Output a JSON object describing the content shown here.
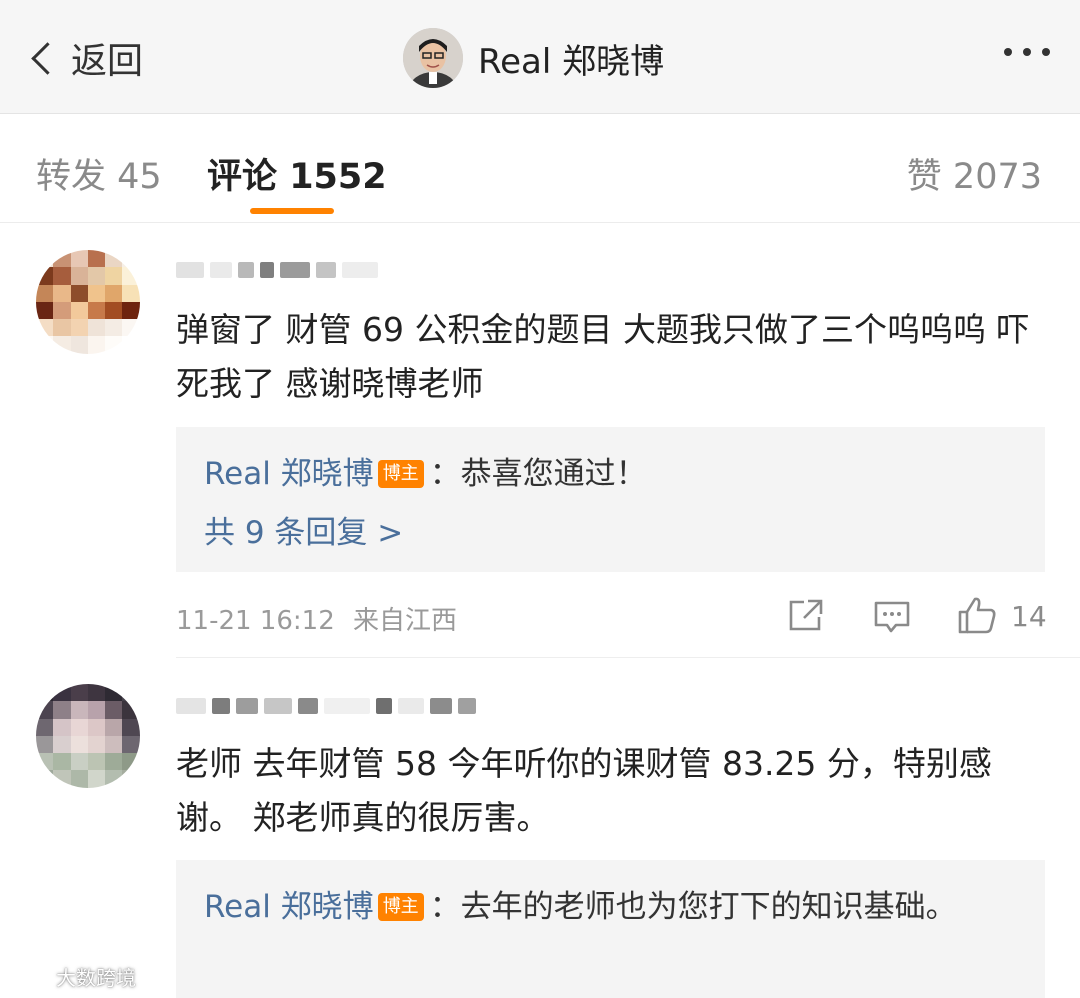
{
  "navbar": {
    "back_label": "返回",
    "title": "Real 郑晓博",
    "more_icon": "more-dots-icon"
  },
  "tabs": [
    {
      "label": "转发",
      "count": "45"
    },
    {
      "label": "评论",
      "count": "1552"
    },
    {
      "label": "赞",
      "count": "2073"
    }
  ],
  "active_tab": "评论",
  "accent_color": "#ff8200",
  "link_color": "#4a6f9b",
  "comments": [
    {
      "text": "弹窗了 财管 69  公积金的题目 大题我只做了三个呜呜呜 吓死我了 感谢晓博老师",
      "reply": {
        "author": "Real 郑晓博",
        "badge": "博主",
        "text": "：恭喜您通过！",
        "more": "共 9 条回复 >"
      },
      "time": "11-21 16:12",
      "location": "来自江西",
      "likes": "14"
    },
    {
      "text": "老师 去年财管 58  今年听你的课财管 83.25 分，特别感谢。 郑老师真的很厉害。",
      "reply": {
        "author": "Real 郑晓博",
        "badge": "博主",
        "text": "：去年的老师也为您打下的知识基础。"
      }
    }
  ],
  "watermark": "大数跨境"
}
